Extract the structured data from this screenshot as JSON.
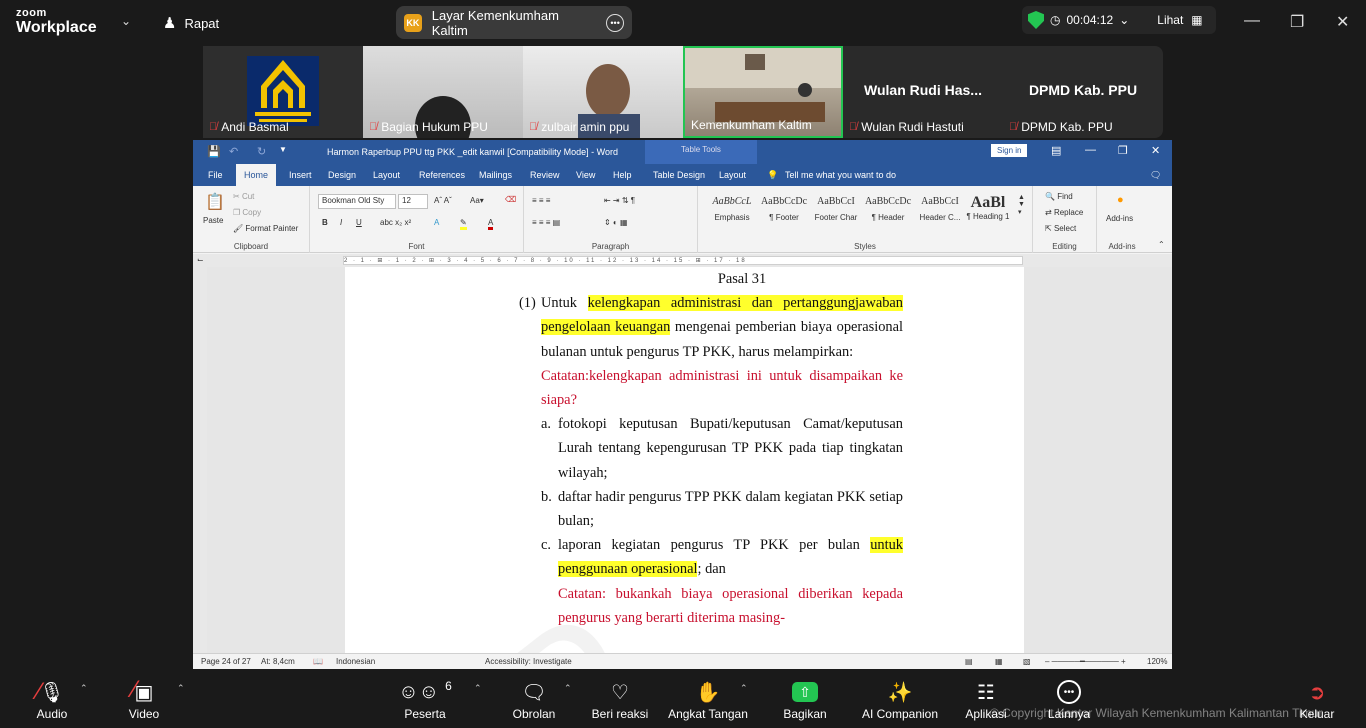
{
  "zoom": {
    "brand_top": "zoom",
    "brand_bottom": "Workplace",
    "meeting_label": "Rapat",
    "share_badge": "KK",
    "share_title": "Layar Kemenkumham Kaltim",
    "timer": "00:04:12",
    "view_label": "Lihat",
    "colors": {
      "bg": "#1a1a1a",
      "accent_green": "#23c552",
      "mic_off": "#e53e3e"
    }
  },
  "participants": [
    {
      "name": "Andi Basmal"
    },
    {
      "name": "Bagian Hukum PPU"
    },
    {
      "name": "zulbair amin ppu"
    },
    {
      "name": "Kemenkumham Kaltim"
    },
    {
      "name": "Wulan Rudi Hastuti",
      "display": "Wulan Rudi Has..."
    },
    {
      "name": "DPMD Kab. PPU",
      "display": "DPMD Kab. PPU"
    }
  ],
  "word": {
    "title": "Harmon Raperbup PPU ttg PKK _edit kanwil [Compatibility Mode] - Word",
    "table_tools": "Table Tools",
    "sign_in": "Sign in",
    "tabs": [
      "File",
      "Home",
      "Insert",
      "Design",
      "Layout",
      "References",
      "Mailings",
      "Review",
      "View",
      "Help",
      "Table Design",
      "Layout"
    ],
    "tell_me": "Tell me what you want to do",
    "ribbon": {
      "paste": "Paste",
      "cut": "Cut",
      "copy": "Copy",
      "format_painter": "Format Painter",
      "clipboard": "Clipboard",
      "font_name": "Bookman Old Sty",
      "font_size": "12",
      "font": "Font",
      "paragraph": "Paragraph",
      "styles": "Styles",
      "style_items": [
        {
          "preview": "AaBbCcL",
          "label": "Emphasis"
        },
        {
          "preview": "AaBbCcDc",
          "label": "¶ Footer"
        },
        {
          "preview": "AaBbCcI",
          "label": "Footer Char"
        },
        {
          "preview": "AaBbCcDc",
          "label": "¶ Header"
        },
        {
          "preview": "AaBbCcI",
          "label": "Header C..."
        },
        {
          "preview": "AaBl",
          "label": "¶ Heading 1"
        }
      ],
      "find": "Find",
      "replace": "Replace",
      "select": "Select",
      "editing": "Editing",
      "addins": "Add-ins",
      "addins_group": "Add-ins"
    },
    "ruler_text": "2 · 1 · ⊞ · 1 · 2 · ⊞ · 3 · 4 · 5 · 6 · 7 · 8 · 9 · 10 · 11 · 12 · 13 · 14 · 15 · ⊞ · 17 · 18",
    "doc": {
      "heading": "Pasal 31",
      "p1_num": "(1)",
      "p1_a": "Untuk ",
      "p1_hl": "kelengkapan administrasi dan pertanggungjawaban pengelolaan keuangan",
      "p1_b": " mengenai pemberian biaya operasional bulanan untuk pengurus TP PKK, harus melampirkan:",
      "note1": "Catatan:kelengkapan administrasi ini untuk disampaikan ke siapa?",
      "a_lbl": "a.",
      "a_txt": "fotokopi keputusan Bupati/keputusan Camat/keputusan Lurah tentang kepengurusan TP PKK pada tiap tingkatan wilayah;",
      "b_lbl": "b.",
      "b_txt": "daftar hadir pengurus TPP PKK dalam kegiatan PKK setiap bulan;",
      "c_lbl": "c.",
      "c_a": "laporan kegiatan pengurus TP PKK per bulan ",
      "c_hl": "untuk penggunaan operasional",
      "c_b": "; dan",
      "note2": "Catatan: bukankah biaya operasional diberikan kepada pengurus yang berarti diterima masing-"
    },
    "status": {
      "page": "Page 24 of 27",
      "at": "At: 8,4cm",
      "lang": "Indonesian",
      "accessibility": "Accessibility: Investigate",
      "zoom": "120%"
    },
    "colors": {
      "titlebar": "#2b579a",
      "highlight": "#ffff2c",
      "note_red": "#c8102e"
    }
  },
  "toolbar": {
    "audio": "Audio",
    "video": "Video",
    "participants": "Peserta",
    "participants_count": "6",
    "chat": "Obrolan",
    "react": "Beri reaksi",
    "raise_hand": "Angkat Tangan",
    "share": "Bagikan",
    "ai": "AI Companion",
    "apps": "Aplikasi",
    "more": "Lainnya",
    "leave": "Keluar",
    "copyright": "© Copyright Kantor Wilayah Kemenkumham Kalimantan Timur"
  }
}
